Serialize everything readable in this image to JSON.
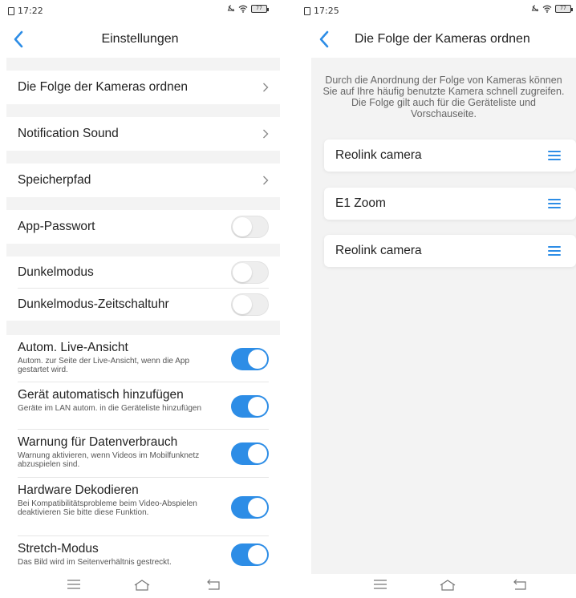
{
  "left": {
    "status": {
      "time": "17:22",
      "battery": "77"
    },
    "nav": {
      "title": "Einstellungen"
    },
    "rows": {
      "order_cameras": "Die Folge der Kameras ordnen",
      "notification_sound": "Notification Sound",
      "storage_path": "Speicherpfad",
      "app_password": "App-Passwort",
      "dark_mode": "Dunkelmodus",
      "dark_mode_timer": "Dunkelmodus-Zeitschaltuhr",
      "auto_live": {
        "title": "Autom. Live-Ansicht",
        "sub": "Autom. zur Seite der Live-Ansicht, wenn die App gestartet wird."
      },
      "auto_add": {
        "title": "Gerät automatisch hinzufügen",
        "sub": "Geräte im LAN autom. in die Geräteliste hinzufügen"
      },
      "data_warning": {
        "title": "Warnung für Datenverbrauch",
        "sub": "Warnung aktivieren, wenn Videos im Mobilfunknetz abzuspielen sind."
      },
      "hw_decoding": {
        "title": "Hardware Dekodieren",
        "sub": "Bei Kompatibilitätsprobleme beim Video-Abspielen deaktivieren Sie bitte diese Funktion."
      },
      "stretch": {
        "title": "Stretch-Modus",
        "sub": "Das Bild wird im Seitenverhältnis gestreckt."
      }
    },
    "toggles": {
      "app_password": false,
      "dark_mode": false,
      "dark_mode_timer": false,
      "auto_live": true,
      "auto_add": true,
      "data_warning": true,
      "hw_decoding": true,
      "stretch": true
    }
  },
  "right": {
    "status": {
      "time": "17:25",
      "battery": "77"
    },
    "nav": {
      "title": "Die Folge der Kameras ordnen"
    },
    "description": "Durch die Anordnung der Folge von Kameras können Sie auf Ihre häufig benutzte Kamera schnell zugreifen. Die Folge gilt auch für die Geräteliste und Vorschauseite.",
    "cameras": [
      "Reolink camera",
      "E1 Zoom",
      "Reolink camera"
    ]
  },
  "colors": {
    "accent": "#2d8de6",
    "section_gap": "#f3f3f3"
  },
  "icons": [
    "back-chevron-icon",
    "chevron-right-icon",
    "drag-handle-icon",
    "menu-icon",
    "home-icon",
    "back-icon",
    "wifi-icon",
    "mute-icon",
    "battery-icon",
    "sim-icon"
  ]
}
